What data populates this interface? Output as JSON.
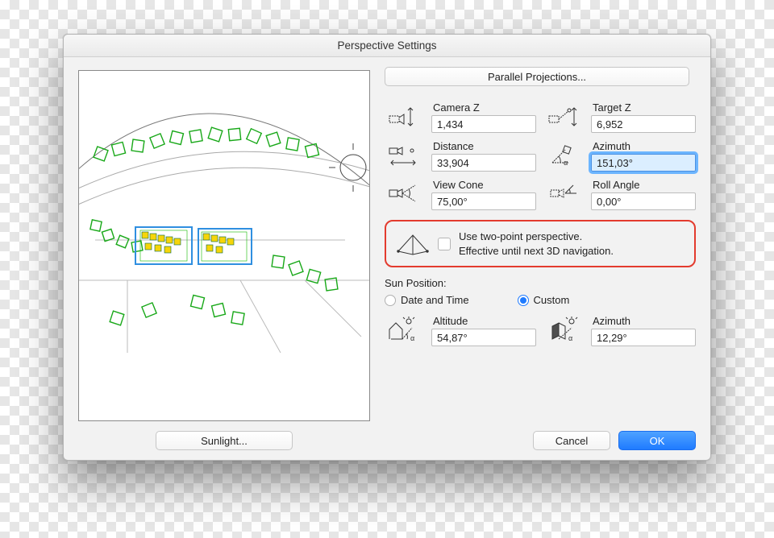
{
  "dialog": {
    "title": "Perspective Settings",
    "parallel_button": "Parallel Projections...",
    "sunlight_button": "Sunlight...",
    "cancel": "Cancel",
    "ok": "OK"
  },
  "fields": {
    "camera_z": {
      "label": "Camera Z",
      "value": "1,434"
    },
    "target_z": {
      "label": "Target Z",
      "value": "6,952"
    },
    "distance": {
      "label": "Distance",
      "value": "33,904"
    },
    "azimuth": {
      "label": "Azimuth",
      "value": "151,03°"
    },
    "view_cone": {
      "label": "View Cone",
      "value": "75,00°"
    },
    "roll": {
      "label": "Roll Angle",
      "value": "0,00°"
    }
  },
  "two_point": {
    "line1": "Use two-point perspective.",
    "line2": "Effective until next 3D navigation.",
    "checked": false
  },
  "sun": {
    "title": "Sun Position:",
    "radio_date": "Date and Time",
    "radio_custom": "Custom",
    "selected": "custom",
    "altitude": {
      "label": "Altitude",
      "value": "54,87°"
    },
    "azimuth": {
      "label": "Azimuth",
      "value": "12,29°"
    }
  }
}
